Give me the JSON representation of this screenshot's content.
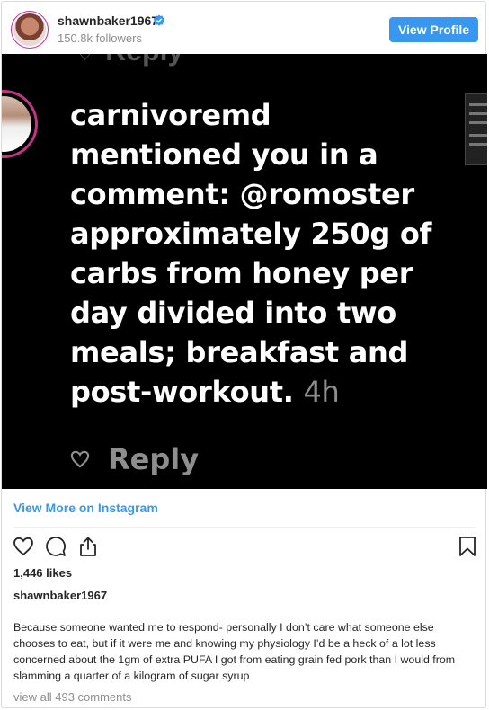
{
  "header": {
    "username": "shawnbaker1967",
    "followers": "150.8k followers",
    "view_profile_label": "View Profile"
  },
  "media": {
    "top_reply_label": "Reply",
    "commenter": "carnivoremd",
    "message_before_mention": "mentioned you in a comment:",
    "mention": "@romoster",
    "message_after_mention": "approximately 250g of carbs from honey per day divided into two meals; breakfast and post-workout.",
    "time": "4h",
    "reply_label": "Reply"
  },
  "view_more_label": "View More on Instagram",
  "likes": "1,446 likes",
  "caption": {
    "username": "shawnbaker1967",
    "text": "Because someone wanted me to respond- personally I don’t care what someone else chooses to eat, but if it were me and knowing my physiology I’d be a heck of a lot less concerned about the 1gm of extra PUFA I got from eating grain fed pork than I would from slamming a quarter of a kilogram of sugar syrup"
  },
  "comments_link": "view all 493 comments",
  "icons": [
    "verified-badge-icon",
    "heart-icon",
    "comment-icon",
    "share-icon",
    "bookmark-icon"
  ],
  "colors": {
    "link_blue": "#3897f0",
    "media_bg": "#000000",
    "muted": "#8e8e8e",
    "story_ring": "#c13584"
  }
}
